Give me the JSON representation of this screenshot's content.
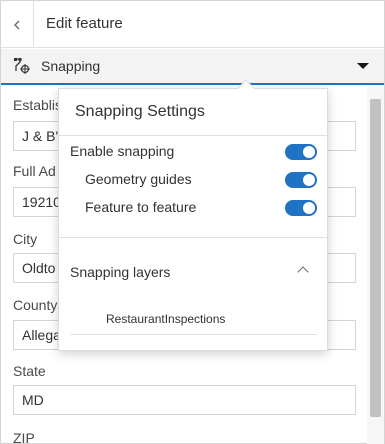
{
  "header": {
    "title": "Edit feature",
    "back_icon": "chevron-left-icon"
  },
  "snapping_bar": {
    "label": "Snapping",
    "icon": "snapping-icon",
    "caret_icon": "caret-down-icon",
    "accent": "#1f73c4"
  },
  "form": {
    "fields": [
      {
        "label": "Establis",
        "value": "J & B'"
      },
      {
        "label": "Full Ad",
        "value": "19210"
      },
      {
        "label": "City",
        "value": "Oldto"
      },
      {
        "label": "County",
        "value": "Allega"
      },
      {
        "label": "State",
        "value": "MD"
      },
      {
        "label": "ZIP",
        "value": ""
      }
    ]
  },
  "popover": {
    "title": "Snapping Settings",
    "toggles": [
      {
        "label": "Enable snapping",
        "on": true
      },
      {
        "label": "Geometry guides",
        "on": true
      },
      {
        "label": "Feature to feature",
        "on": true
      }
    ],
    "layers_label": "Snapping layers",
    "layers_icon": "chevron-up-icon",
    "layers": [
      "RestaurantInspections"
    ]
  }
}
